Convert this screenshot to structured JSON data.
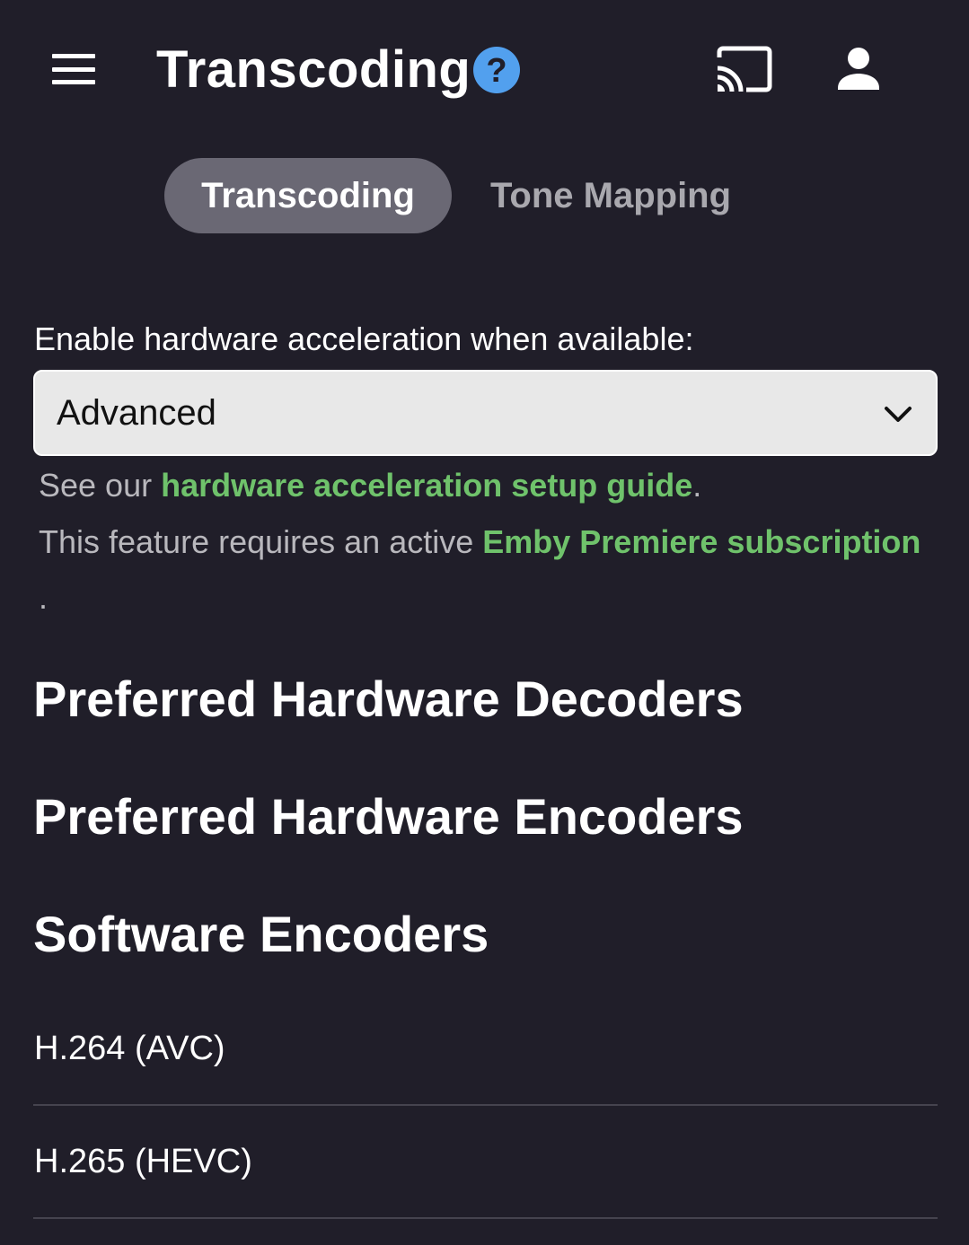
{
  "header": {
    "menu_icon": "hamburger-menu-icon",
    "title": "Transcoding",
    "help_icon": "question-circle-icon",
    "cast_icon": "cast-icon",
    "user_icon": "person-icon",
    "help_color": "#52a0ee"
  },
  "tabs": [
    {
      "label": "Transcoding",
      "active": true
    },
    {
      "label": "Tone Mapping",
      "active": false
    }
  ],
  "hardware_acceleration": {
    "label": "Enable hardware acceleration when available:",
    "selected": "Advanced",
    "help_prefix": "See our ",
    "help_link": "hardware acceleration setup guide",
    "help_suffix": ".",
    "premiere_prefix": "This feature requires an active ",
    "premiere_link": "Emby Premiere subscription",
    "premiere_suffix": ".",
    "link_color": "#6fc26b"
  },
  "sections": {
    "decoders_title": "Preferred Hardware Decoders",
    "encoders_title": "Preferred Hardware Encoders",
    "software_title": "Software Encoders"
  },
  "software_encoders": [
    {
      "label": "H.264 (AVC)"
    },
    {
      "label": "H.265 (HEVC)"
    }
  ]
}
